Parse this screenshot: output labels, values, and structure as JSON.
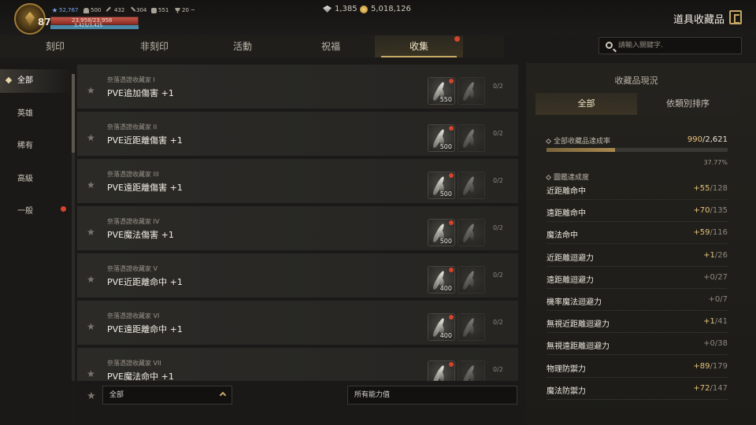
{
  "player": {
    "level": "87",
    "stats": [
      {
        "icon": "blue-star-icon",
        "value": "52,767",
        "color": "#7aa7e8"
      },
      {
        "icon": "helmet-icon",
        "value": "500"
      },
      {
        "icon": "sword-icon",
        "value": "432"
      },
      {
        "icon": "blade-icon",
        "value": "304"
      },
      {
        "icon": "bag-icon",
        "value": "551"
      },
      {
        "icon": "trophy-icon",
        "value": "20"
      }
    ],
    "hp_text": "23,958/23,958",
    "hp_fraction": 1.0,
    "mp_text": "3,425/3,425",
    "mp_fraction": 1.0
  },
  "currency": {
    "crystal": "1,385",
    "gold": "5,018,126"
  },
  "page_title": "道具收藏品",
  "tabs": [
    {
      "label": "刻印",
      "active": false,
      "badge": false
    },
    {
      "label": "非刻印",
      "active": false,
      "badge": false
    },
    {
      "label": "活動",
      "active": false,
      "badge": false
    },
    {
      "label": "祝福",
      "active": false,
      "badge": false
    },
    {
      "label": "收集",
      "active": true,
      "badge": true
    }
  ],
  "search": {
    "placeholder": "請輸入關鍵字."
  },
  "categories": [
    {
      "label": "全部",
      "active": true,
      "badge": false
    },
    {
      "label": "英雄",
      "active": false,
      "badge": false
    },
    {
      "label": "稀有",
      "active": false,
      "badge": false
    },
    {
      "label": "高級",
      "active": false,
      "badge": false
    },
    {
      "label": "一般",
      "active": false,
      "badge": true
    }
  ],
  "collections": [
    {
      "subtitle": "奈落憑證收藏家 I",
      "name": "PVE追加傷害 +1",
      "qty": "550",
      "progress": "0/2"
    },
    {
      "subtitle": "奈落憑證收藏家 II",
      "name": "PVE近距離傷害 +1",
      "qty": "500",
      "progress": "0/2"
    },
    {
      "subtitle": "奈落憑證收藏家 III",
      "name": "PVE遠距離傷害 +1",
      "qty": "500",
      "progress": "0/2"
    },
    {
      "subtitle": "奈落憑證收藏家 IV",
      "name": "PVE魔法傷害 +1",
      "qty": "500",
      "progress": "0/2"
    },
    {
      "subtitle": "奈落憑證收藏家 V",
      "name": "PVE近距離命中 +1",
      "qty": "400",
      "progress": "0/2"
    },
    {
      "subtitle": "奈落憑證收藏家 VI",
      "name": "PVE遠距離命中 +1",
      "qty": "400",
      "progress": "0/2"
    },
    {
      "subtitle": "奈落憑證收藏家 VII",
      "name": "PVE魔法命中 +1",
      "qty": "",
      "progress": "0/2"
    }
  ],
  "filters": {
    "grade": "全部",
    "ability": "所有能力值"
  },
  "status_panel": {
    "title": "收藏品現況",
    "tabs": [
      {
        "label": "全部",
        "active": true
      },
      {
        "label": "依類別排序",
        "active": false
      }
    ],
    "overall_label": "全部收藏品達成率",
    "overall_done": "990",
    "overall_total": "/2,621",
    "overall_fraction": 0.3777,
    "overall_percent": "37.77%",
    "codex_label": "圖鑑達成度",
    "stats": [
      {
        "label": "近距離命中",
        "bonus": "+55",
        "total": "/128"
      },
      {
        "label": "遠距離命中",
        "bonus": "+70",
        "total": "/135"
      },
      {
        "label": "魔法命中",
        "bonus": "+59",
        "total": "/116"
      },
      {
        "label": "近距離迴避力",
        "bonus": "+1",
        "total": "/26"
      },
      {
        "label": "遠距離迴避力",
        "bonus": "+0",
        "total": "/27"
      },
      {
        "label": "機率魔法迴避力",
        "bonus": "+0",
        "total": "/7"
      },
      {
        "label": "無視近距離迴避力",
        "bonus": "+1",
        "total": "/41"
      },
      {
        "label": "無視遠距離迴避力",
        "bonus": "+0",
        "total": "/38"
      },
      {
        "label": "物理防禦力",
        "bonus": "+89",
        "total": "/179"
      },
      {
        "label": "魔法防禦力",
        "bonus": "+72",
        "total": "/147"
      }
    ]
  }
}
